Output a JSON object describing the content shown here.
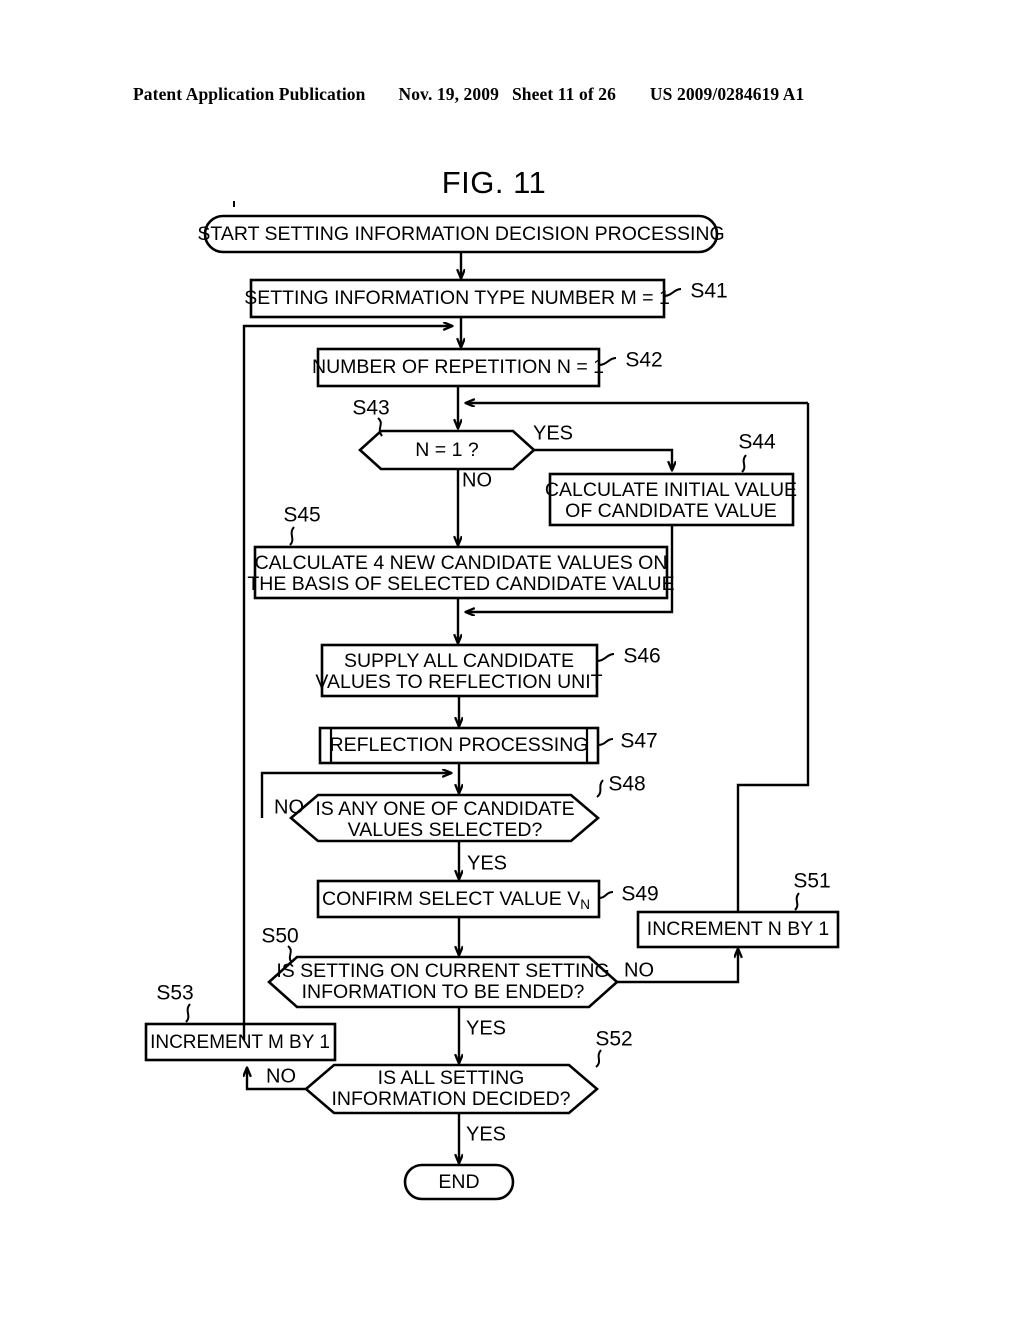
{
  "header": {
    "publication": "Patent Application Publication",
    "date": "Nov. 19, 2009",
    "sheet": "Sheet 11 of 26",
    "number": "US 2009/0284619 A1"
  },
  "figure": {
    "title": "FIG. 11"
  },
  "flowchart": {
    "type": "flowchart",
    "nodes": {
      "start": {
        "shape": "terminal",
        "label": "START SETTING INFORMATION DECISION PROCESSING"
      },
      "s41": {
        "step": "S41",
        "shape": "process",
        "label": "SETTING INFORMATION TYPE NUMBER M = 1"
      },
      "s42": {
        "step": "S42",
        "shape": "process",
        "label": "NUMBER OF REPETITION N = 1"
      },
      "s43": {
        "step": "S43",
        "shape": "decision",
        "label": "N = 1 ?",
        "branch_yes": "YES",
        "branch_no": "NO"
      },
      "s44": {
        "step": "S44",
        "shape": "process",
        "line1": "CALCULATE INITIAL VALUE",
        "line2": "OF CANDIDATE VALUE"
      },
      "s45": {
        "step": "S45",
        "shape": "process",
        "line1": "CALCULATE 4 NEW CANDIDATE VALUES ON",
        "line2": "THE BASIS OF SELECTED CANDIDATE VALUE"
      },
      "s46": {
        "step": "S46",
        "shape": "process",
        "line1": "SUPPLY ALL CANDIDATE",
        "line2": "VALUES TO REFLECTION UNIT"
      },
      "s47": {
        "step": "S47",
        "shape": "predefined-process",
        "label": "REFLECTION PROCESSING"
      },
      "s48": {
        "step": "S48",
        "shape": "decision",
        "line1": "IS ANY ONE OF CANDIDATE",
        "line2": "VALUES SELECTED?",
        "branch_no": "NO",
        "branch_yes": "YES"
      },
      "s49": {
        "step": "S49",
        "shape": "process",
        "label": "CONFIRM SELECT VALUE V",
        "subscript": "N"
      },
      "s50": {
        "step": "S50",
        "shape": "decision",
        "line1": "IS SETTING ON CURRENT SETTING",
        "line2": "INFORMATION TO BE ENDED?",
        "branch_no": "NO",
        "branch_yes": "YES"
      },
      "s51": {
        "step": "S51",
        "shape": "process",
        "label": "INCREMENT N BY 1"
      },
      "s52": {
        "step": "S52",
        "shape": "decision",
        "line1": "IS ALL SETTING",
        "line2": "INFORMATION DECIDED?",
        "branch_no": "NO",
        "branch_yes": "YES"
      },
      "s53": {
        "step": "S53",
        "shape": "process",
        "label": "INCREMENT M BY 1"
      },
      "end": {
        "shape": "terminal",
        "label": "END"
      }
    }
  }
}
